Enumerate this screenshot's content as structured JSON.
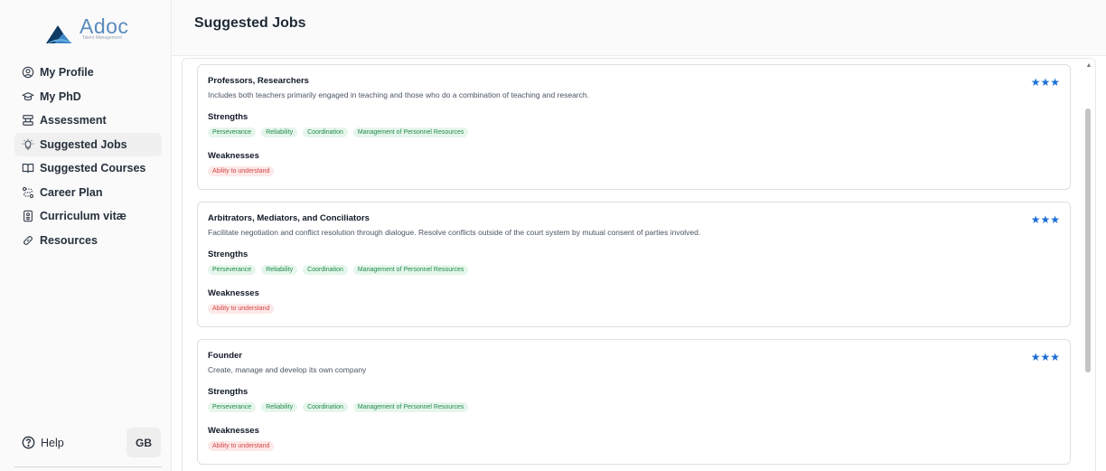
{
  "brand": {
    "name": "Adoc",
    "tagline": "Talent Management"
  },
  "nav": [
    {
      "label": "My Profile",
      "icon": "user-circle-icon"
    },
    {
      "label": "My PhD",
      "icon": "graduation-cap-icon"
    },
    {
      "label": "Assessment",
      "icon": "assessment-icon"
    },
    {
      "label": "Suggested Jobs",
      "icon": "lightbulb-icon",
      "active": true
    },
    {
      "label": "Suggested Courses",
      "icon": "book-open-icon"
    },
    {
      "label": "Career Plan",
      "icon": "route-icon"
    },
    {
      "label": "Curriculum vitæ",
      "icon": "document-icon"
    },
    {
      "label": "Resources",
      "icon": "link-icon"
    }
  ],
  "footer": {
    "help_label": "Help",
    "user_initials": "GB"
  },
  "page": {
    "title": "Suggested Jobs"
  },
  "labels": {
    "strengths": "Strengths",
    "weaknesses": "Weaknesses",
    "stars": "★★★"
  },
  "colors": {
    "accent": "#1d6fd6",
    "strength_bg": "#e6f6ec",
    "strength_text": "#1f8a4c",
    "weakness_bg": "#fde8e8",
    "weakness_text": "#d64545"
  },
  "jobs": [
    {
      "title": "Professors, Researchers",
      "description": "Includes both teachers primarily engaged in teaching and those who do a combination of teaching and research.",
      "rating": 3,
      "strengths": [
        "Perseverance",
        "Reliability",
        "Coordination",
        "Management of Personnel Resources"
      ],
      "weaknesses": [
        "Ability to understand"
      ]
    },
    {
      "title": "Arbitrators, Mediators, and Conciliators",
      "description": "Facilitate negotiation and conflict resolution through dialogue. Resolve conflicts outside of the court system by mutual consent of parties involved.",
      "rating": 3,
      "strengths": [
        "Perseverance",
        "Reliability",
        "Coordination",
        "Management of Personnel Resources"
      ],
      "weaknesses": [
        "Ability to understand"
      ]
    },
    {
      "title": "Founder",
      "description": "Create, manage and develop its own company",
      "rating": 3,
      "strengths": [
        "Perseverance",
        "Reliability",
        "Coordination",
        "Management of Personnel Resources"
      ],
      "weaknesses": [
        "Ability to understand"
      ]
    }
  ]
}
